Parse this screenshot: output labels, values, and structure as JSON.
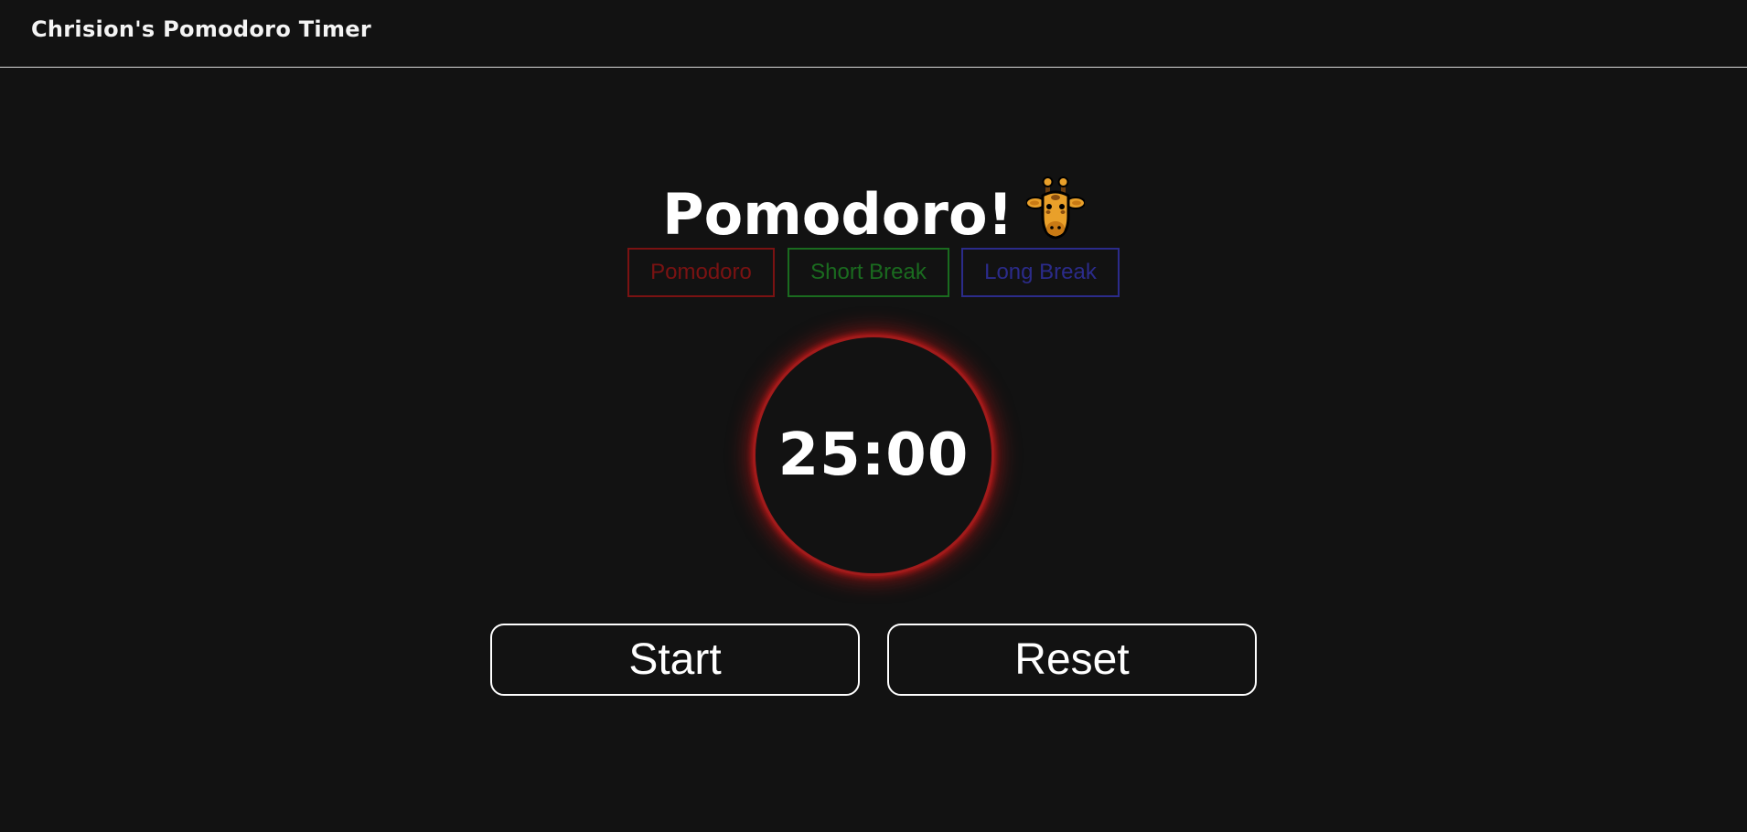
{
  "header": {
    "brand": "Chrision's Pomodoro Timer"
  },
  "main": {
    "title": "Pomodoro!",
    "title_icon": "giraffe-icon",
    "modes": [
      {
        "label": "Pomodoro",
        "color": "#7a1212"
      },
      {
        "label": "Short Break",
        "color": "#1a6b1f"
      },
      {
        "label": "Long Break",
        "color": "#2b2b8a"
      }
    ],
    "timer": {
      "display": "25:00",
      "ring_color": "#c81414"
    },
    "actions": {
      "start_label": "Start",
      "reset_label": "Reset"
    }
  },
  "colors": {
    "background": "#121212",
    "text": "#ffffff"
  }
}
